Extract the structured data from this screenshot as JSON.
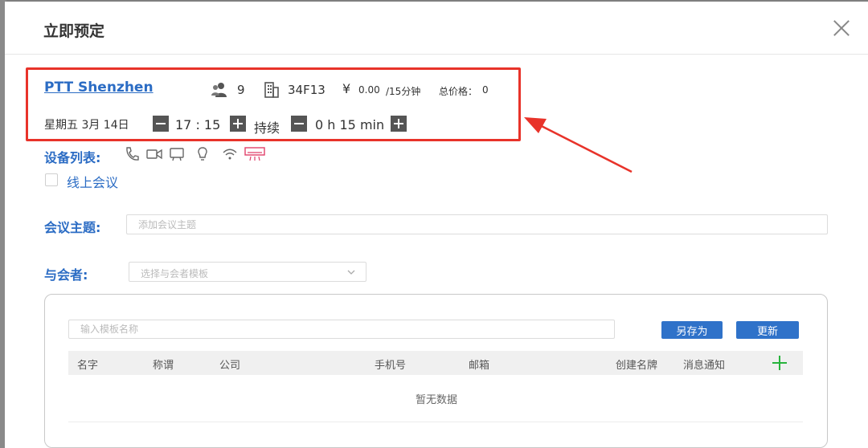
{
  "modal": {
    "title": "立即预定"
  },
  "booking": {
    "location": "PTT Shenzhen",
    "people": "9",
    "room": "34F13",
    "currency": "¥",
    "price": "0.00",
    "price_unit": "/15分钟",
    "total_label": "总价格：",
    "total_value": "0",
    "date": "星期五 3月 14日",
    "time": "17 : 15",
    "duration_label": "持续",
    "duration": "0 h 15 min"
  },
  "equipment": {
    "label": "设备列表:",
    "icons": [
      "phone-icon",
      "video-camera-icon",
      "screen-icon",
      "lightbulb-icon",
      "wifi-icon",
      "air-conditioner-icon"
    ]
  },
  "online": {
    "label": "线上会议"
  },
  "topic": {
    "label": "会议主题:",
    "placeholder": "添加会议主题"
  },
  "attendees": {
    "label": "与会者:",
    "placeholder": "选择与会者模板"
  },
  "template": {
    "placeholder": "输入模板名称",
    "save_as": "另存为",
    "update": "更新",
    "columns": [
      "名字",
      "称谓",
      "公司",
      "手机号",
      "邮箱",
      "创建名牌",
      "消息通知"
    ],
    "empty": "暂无数据"
  },
  "colors": {
    "accent": "#2b6cc4",
    "button": "#2f72c9",
    "highlight": "#e8332a",
    "add": "#27b43c"
  }
}
